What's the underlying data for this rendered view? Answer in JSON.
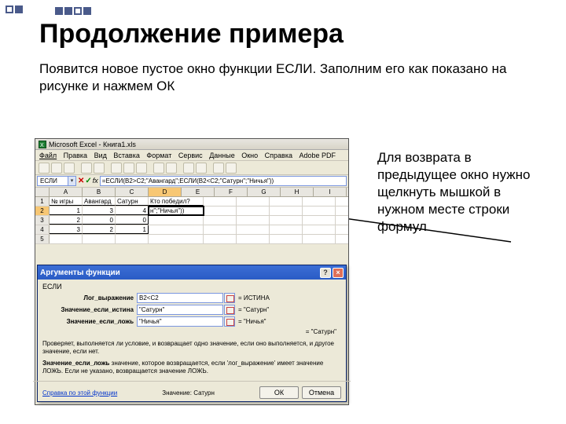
{
  "slide": {
    "title": "Продолжение примера",
    "subtitle": "Появится новое пустое окно функции ЕСЛИ. Заполним его как показано на рисунке и нажмем ОК",
    "sidenote": "Для возврата в предыдущее окно нужно щелкнуть мышкой в нужном месте строки формул"
  },
  "excel": {
    "window_title": "Microsoft Excel - Книга1.xls",
    "menu": [
      "Файл",
      "Правка",
      "Вид",
      "Вставка",
      "Формат",
      "Сервис",
      "Данные",
      "Окно",
      "Справка",
      "Adobe PDF"
    ],
    "namebox": "ЕСЛИ",
    "formula": "=ЕСЛИ(B2>C2;\"Авангард\";ЕСЛИ(B2<C2;\"Сатурн\";\"Ничья\"))",
    "columns": [
      "A",
      "B",
      "C",
      "D",
      "E",
      "F",
      "G",
      "H",
      "I"
    ],
    "rows": [
      {
        "n": "1",
        "cells": [
          "№ игры",
          "Авангард",
          "Сатурн",
          "Кто победил?",
          "",
          "",
          "",
          "",
          ""
        ]
      },
      {
        "n": "2",
        "cells": [
          "1",
          "3",
          "4",
          "н\";\"Ничья\"))",
          "",
          "",
          "",
          "",
          ""
        ]
      },
      {
        "n": "3",
        "cells": [
          "2",
          "0",
          "0",
          "",
          "",
          "",
          "",
          "",
          ""
        ]
      },
      {
        "n": "4",
        "cells": [
          "3",
          "2",
          "1",
          "",
          "",
          "",
          "",
          "",
          ""
        ]
      }
    ],
    "active_col": "D",
    "active_row": "2"
  },
  "dialog": {
    "title": "Аргументы функции",
    "function": "ЕСЛИ",
    "args": [
      {
        "label": "Лог_выражение",
        "value": "B2<C2",
        "result": "= ИСТИНА"
      },
      {
        "label": "Значение_если_истина",
        "value": "\"Сатурн\"",
        "result": "= \"Сатурн\""
      },
      {
        "label": "Значение_если_ложь",
        "value": "\"Ничья\"",
        "result": "= \"Ничья\""
      }
    ],
    "overall_result": "= \"Сатурн\"",
    "description": "Проверяет, выполняется ли условие, и возвращает одно значение, если оно выполняется, и другое значение, если нет.",
    "arg_desc_label": "Значение_если_ложь",
    "arg_desc_text": "значение, которое возвращается, если 'лог_выражение' имеет значение ЛОЖЬ. Если не указано, возвращается значение ЛОЖЬ.",
    "help_link": "Справка по этой функции",
    "value_label": "Значение:",
    "value": "Сатурн",
    "ok": "ОК",
    "cancel": "Отмена"
  }
}
